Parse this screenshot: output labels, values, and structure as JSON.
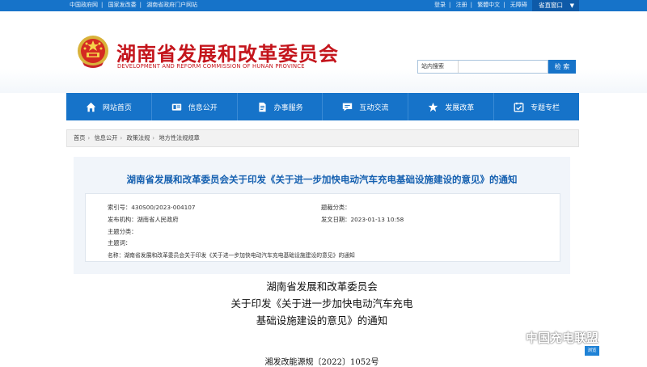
{
  "topbar": {
    "left_links": [
      "中国政府网",
      "国家发改委",
      "湖南省政府门户网站"
    ],
    "right_links": [
      "登录",
      "注册",
      "繁體中文",
      "无障碍"
    ],
    "portal_label": "省直窗口"
  },
  "header": {
    "title": "湖南省发展和改革委员会",
    "subtitle": "DEVELOPMENT AND REFORM COMMISSION OF HUNAN PROVINCE",
    "search_scope": "站内搜索",
    "search_placeholder": "",
    "search_button": "检 索"
  },
  "nav": {
    "items": [
      {
        "label": "网站首页",
        "icon": "home-icon"
      },
      {
        "label": "信息公开",
        "icon": "info-card-icon"
      },
      {
        "label": "办事服务",
        "icon": "document-icon"
      },
      {
        "label": "互动交流",
        "icon": "chat-icon"
      },
      {
        "label": "发展改革",
        "icon": "star-icon"
      },
      {
        "label": "专题专栏",
        "icon": "checklist-icon"
      }
    ]
  },
  "breadcrumb": [
    "首页",
    "信息公开",
    "政策法规",
    "地方性法规规章"
  ],
  "article": {
    "title": "湖南省发展和改革委员会关于印发《关于进一步加快电动汽车充电基础设施建设的意见》的通知",
    "meta": {
      "index_label": "索引号：",
      "index_value": "430S00/2023-004107",
      "category_label": "题裁分类：",
      "category_value": "",
      "publisher_label": "发布机构：",
      "publisher_value": "湖南省人民政府",
      "date_label": "发文日期：",
      "date_value": "2023-01-13 10:58",
      "topic_class_label": "主题分类：",
      "topic_class_value": "",
      "keywords_label": "主题词：",
      "keywords_value": "",
      "name_label": "名称：",
      "name_value": "湖南省发展和改革委员会关于印发《关于进一步加快电动汽车充电基础设施建设的意见》的通知"
    },
    "body_lines": [
      "湖南省发展和改革委员会",
      "关于印发《关于进一步加快电动汽车充电",
      "基础设施建设的意见》的通知"
    ],
    "doc_number": "湘发改能源规〔2022〕1052号"
  },
  "watermark": {
    "text": "中国充电联盟",
    "badge": "浏览"
  },
  "colors": {
    "brand_blue": "#1673c9",
    "brand_red": "#c4151c",
    "title_blue": "#1560b0"
  }
}
